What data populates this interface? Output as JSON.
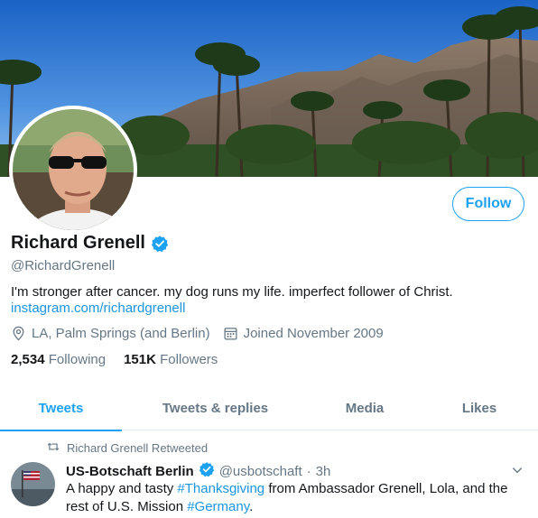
{
  "profile": {
    "name": "Richard Grenell",
    "handle": "@RichardGrenell",
    "bio": "I'm stronger after cancer. my dog runs my life. imperfect follower of Christ.",
    "link": "instagram.com/richardgrenell",
    "location": "LA, Palm Springs (and Berlin)",
    "joined": "Joined November 2009",
    "following_count": "2,534",
    "following_label": "Following",
    "followers_count": "151K",
    "followers_label": "Followers",
    "follow_button": "Follow"
  },
  "tabs": [
    {
      "label": "Tweets",
      "active": true
    },
    {
      "label": "Tweets & replies",
      "active": false
    },
    {
      "label": "Media",
      "active": false
    },
    {
      "label": "Likes",
      "active": false
    }
  ],
  "tweet": {
    "retweet_note": "Richard Grenell Retweeted",
    "author_name": "US-Botschaft Berlin",
    "author_handle": "@usbotschaft",
    "separator": "·",
    "time": "3h",
    "text_part1": "A happy and tasty ",
    "hashtag1": "#Thanksgiving",
    "text_part2": " from Ambassador Grenell, Lola, and the rest of U.S. Mission ",
    "hashtag2": "#Germany",
    "text_part3": "."
  },
  "colors": {
    "accent": "#1da1f2",
    "link": "#1b95e0",
    "muted": "#657786",
    "text": "#14171a"
  },
  "icons": {
    "verified": "verified-badge-icon",
    "location": "location-pin-icon",
    "calendar": "calendar-icon",
    "retweet": "retweet-icon",
    "caret": "chevron-down-icon"
  }
}
